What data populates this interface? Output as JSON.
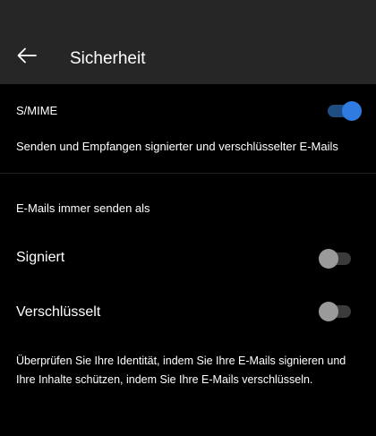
{
  "header": {
    "back_icon": "arrow-left-icon",
    "title": "Sicherheit"
  },
  "smime": {
    "label": "S/MIME",
    "enabled": true,
    "description": "Senden und Empfangen signierter und verschlüsselter E-Mails"
  },
  "send_as": {
    "section_label": "E-Mails immer senden als",
    "options": [
      {
        "label": "Signiert",
        "enabled": false
      },
      {
        "label": "Verschlüsselt",
        "enabled": false
      }
    ]
  },
  "footnote": "Überprüfen Sie Ihre Identität, indem Sie Ihre E-Mails signieren und Ihre Inhalte schützen, indem Sie Ihre E-Mails verschlüsseln.",
  "colors": {
    "background": "#000000",
    "header_background": "#262626",
    "toggle_on_thumb": "#2f7be0",
    "toggle_on_track": "#1f4e82",
    "toggle_off_thumb": "#9a9a9a",
    "toggle_off_track": "#3b3b3b"
  }
}
